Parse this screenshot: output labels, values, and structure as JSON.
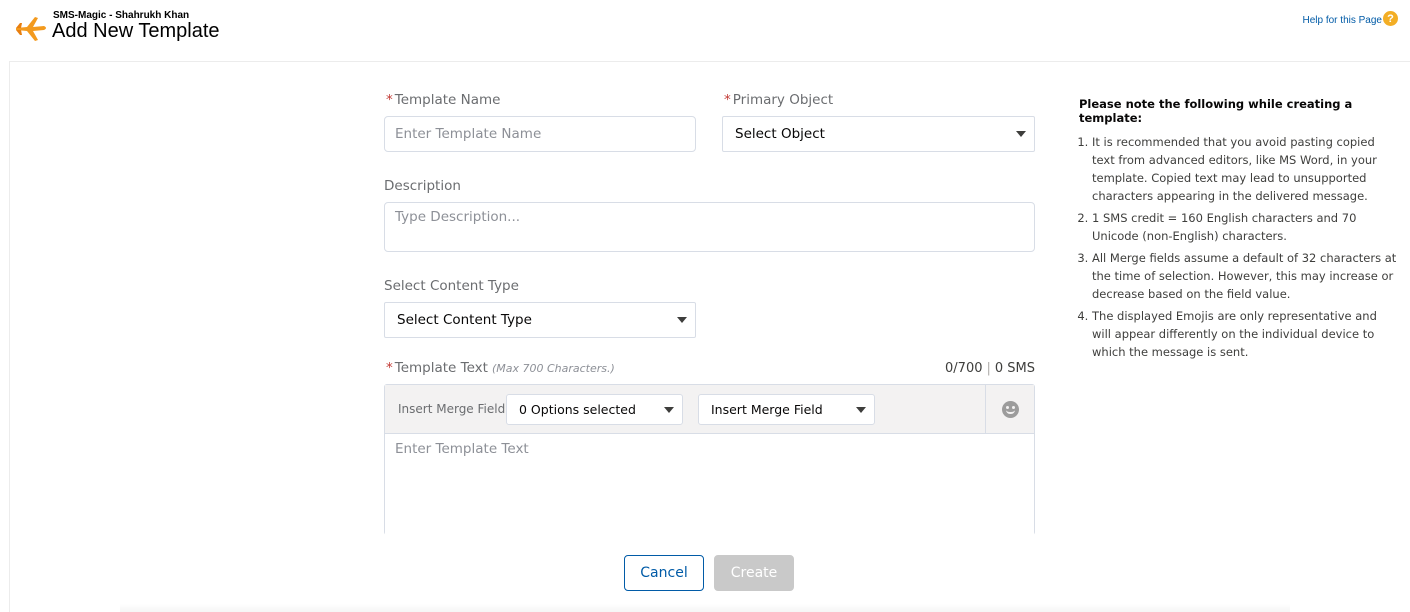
{
  "header": {
    "app_name": "SMS-Magic - Shahrukh Khan",
    "title": "Add New Template",
    "help_link": "Help for this Page",
    "help_icon_glyph": "?"
  },
  "form": {
    "template_name": {
      "label": "Template Name",
      "placeholder": "Enter Template Name",
      "value": ""
    },
    "primary_object": {
      "label": "Primary Object",
      "selected": "Select Object"
    },
    "description": {
      "label": "Description",
      "placeholder": "Type Description...",
      "value": ""
    },
    "content_type": {
      "label": "Select Content Type",
      "selected": "Select Content Type"
    },
    "template_text": {
      "label": "Template Text",
      "hint": "(Max 700 Characters.)",
      "counter_chars": "0/700",
      "counter_sms": "0 SMS",
      "placeholder": "Enter Template Text",
      "value": ""
    },
    "toolbar": {
      "insert_merge_field_label": "Insert Merge Field",
      "options_select": "0 Options selected",
      "merge_field_select": "Insert Merge Field"
    },
    "required_marker": "*"
  },
  "buttons": {
    "cancel": "Cancel",
    "create": "Create"
  },
  "notes": {
    "title": "Please note the following while creating a template:",
    "items": [
      "It is recommended that you avoid pasting copied text from advanced editors, like MS Word, in your template. Copied text may lead to unsupported characters appearing in the delivered message.",
      "1 SMS credit = 160 English characters and 70 Unicode (non-English) characters.",
      "All Merge fields assume a default of 32 characters at the time of selection. However, this may increase or decrease based on the field value.",
      "The displayed Emojis are only representative and will appear differently on the individual device to which the message is sent."
    ]
  },
  "colors": {
    "link": "#015ba7",
    "required": "#c23934",
    "help_icon": "#f3ae25",
    "disabled_button": "#c9c9c9"
  },
  "icons": {
    "logo": "plane-logo-icon",
    "help": "help-icon",
    "emoji": "emoji-icon",
    "dropdown": "chevron-down-icon"
  }
}
